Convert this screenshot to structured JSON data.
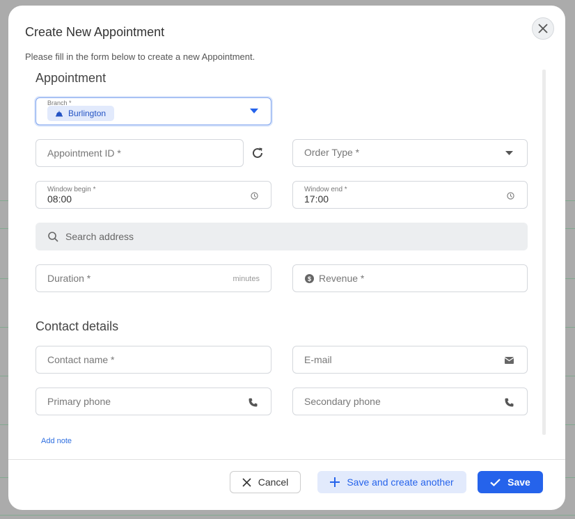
{
  "dialog": {
    "title": "Create New Appointment",
    "subtitle": "Please fill in the form below to create a new Appointment.",
    "close_icon": "close-icon"
  },
  "sections": {
    "appointment": "Appointment",
    "contact": "Contact details"
  },
  "fields": {
    "branch": {
      "label": "Branch *",
      "value": "Burlington"
    },
    "appointment_id": {
      "placeholder": "Appointment ID *"
    },
    "order_type": {
      "placeholder": "Order Type *"
    },
    "window_begin": {
      "label": "Window begin *",
      "value": "08:00"
    },
    "window_end": {
      "label": "Window end *",
      "value": "17:00"
    },
    "search_address": {
      "placeholder": "Search address"
    },
    "duration": {
      "placeholder": "Duration *",
      "suffix": "minutes"
    },
    "revenue": {
      "placeholder": "Revenue *"
    },
    "contact_name": {
      "placeholder": "Contact name *"
    },
    "email": {
      "placeholder": "E-mail"
    },
    "primary_phone": {
      "placeholder": "Primary phone"
    },
    "secondary_phone": {
      "placeholder": "Secondary phone"
    }
  },
  "add_note": "Add note",
  "footer": {
    "cancel": "Cancel",
    "save_another": "Save and create another",
    "save": "Save"
  },
  "colors": {
    "accent": "#2563eb",
    "accent_light": "#e2eafc"
  }
}
